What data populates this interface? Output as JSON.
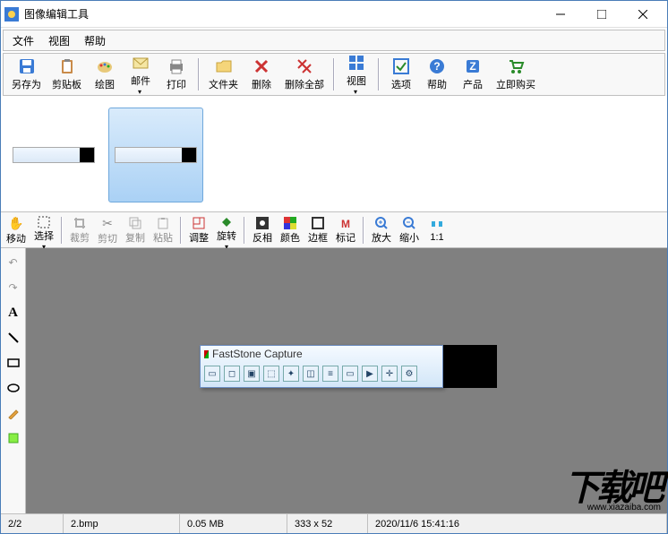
{
  "titlebar": {
    "title": "图像编辑工具"
  },
  "menu": {
    "file": "文件",
    "view": "视图",
    "help": "帮助"
  },
  "toolbar": {
    "saveAs": "另存为",
    "clipboard": "剪贴板",
    "draw": "绘图",
    "mail": "邮件",
    "print": "打印",
    "folder": "文件夹",
    "delete": "删除",
    "deleteAll": "删除全部",
    "view": "视图",
    "options": "选项",
    "help": "帮助",
    "product": "产品",
    "buyNow": "立即购买"
  },
  "secToolbar": {
    "move": "移动",
    "select": "选择",
    "crop": "裁剪",
    "cut": "剪切",
    "copy": "复制",
    "paste": "粘贴",
    "resize": "调整",
    "rotate": "旋转",
    "invert": "反相",
    "color": "颜色",
    "border": "边框",
    "mark": "标记",
    "zoomIn": "放大",
    "zoomOut": "缩小",
    "oneToOne": "1:1"
  },
  "fsCapture": {
    "title": "FastStone Capture"
  },
  "statusbar": {
    "index": "2/2",
    "filename": "2.bmp",
    "size": "0.05 MB",
    "dimensions": "333 x 52",
    "datetime": "2020/11/6 15:41:16"
  },
  "watermark": {
    "big": "下载吧",
    "url": "www.xiazaiba.com"
  }
}
